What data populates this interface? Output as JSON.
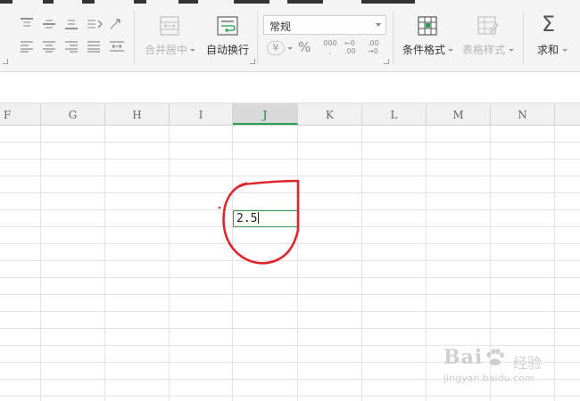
{
  "ribbon": {
    "merge_center_label": "合并居中",
    "auto_wrap_label": "自动换行",
    "number_format": {
      "selected": "常规"
    },
    "percent_symbol": "%",
    "currency_symbol": "¥",
    "thousands_symbol": "000",
    "decimal_increase_symbol": "←0 .00",
    "decimal_decrease_symbol": ".00 →0",
    "conditional_format_label": "条件格式",
    "table_style_label": "表格样式",
    "sum_label": "求和",
    "sum_symbol": "Σ"
  },
  "columns": [
    "F",
    "G",
    "H",
    "I",
    "J",
    "K",
    "L",
    "M",
    "N"
  ],
  "active_column": "J",
  "active_cell": {
    "value": "2.5"
  },
  "colors": {
    "selection": "#2a9d4f",
    "annotation": "#e0242c",
    "ribbon_bg": "#f4f4f4",
    "grid_line": "#e2e2e2"
  },
  "icons": {
    "valign_top": "align-top-icon",
    "valign_middle": "align-middle-icon",
    "valign_bottom": "align-bottom-icon",
    "merge": "merge-cells-icon",
    "wrap": "wrap-text-icon",
    "conditional": "conditional-format-icon",
    "table_style": "table-style-icon",
    "sum": "sum-icon"
  },
  "watermark": {
    "brand": "Bai",
    "brand_suffix": "经验",
    "url": "jingyan.baidu.com"
  }
}
